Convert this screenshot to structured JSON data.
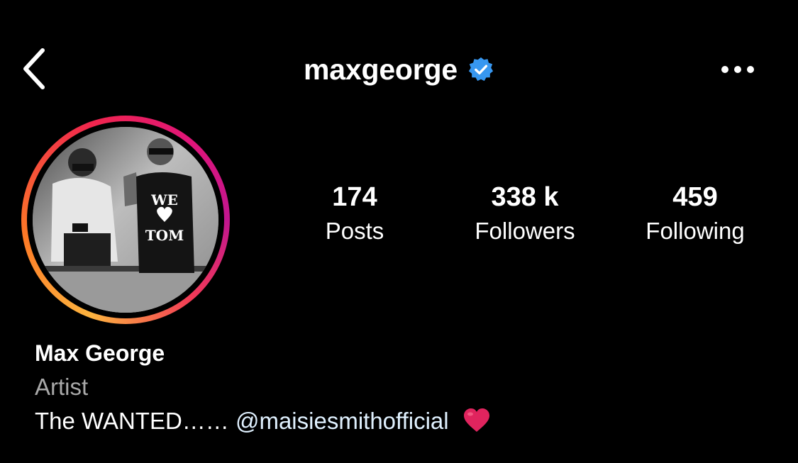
{
  "header": {
    "username": "maxgeorge",
    "back_icon": "chevron-left-icon",
    "verified_icon": "verified-badge-icon",
    "more_icon": "more-horizontal-icon"
  },
  "profile": {
    "avatar_icon": "profile-photo",
    "avatar_shirt_text": [
      "WE",
      "TOM"
    ],
    "stats": {
      "posts": {
        "value": "174",
        "label": "Posts"
      },
      "followers": {
        "value": "338 k",
        "label": "Followers"
      },
      "following": {
        "value": "459",
        "label": "Following"
      }
    },
    "full_name": "Max George",
    "category": "Artist",
    "bio_prefix": "The WANTED…… ",
    "bio_mention": "@maisiesmithofficial",
    "bio_emoji": "red-heart-emoji"
  },
  "colors": {
    "background": "#000000",
    "text": "#ffffff",
    "secondary_text": "#a8a8a8",
    "verified": "#3797f0",
    "heart": "#e0245e"
  }
}
